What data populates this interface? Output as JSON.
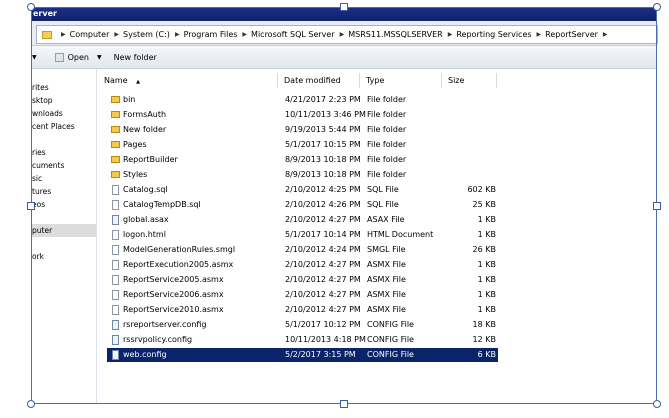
{
  "window": {
    "title_fragment": "erver"
  },
  "address": {
    "crumbs": [
      "Computer",
      "System (C:)",
      "Program Files",
      "Microsoft SQL Server",
      "MSRS11.MSSQLSERVER",
      "Reporting Services",
      "ReportServer"
    ]
  },
  "toolbar": {
    "open_label": "Open",
    "new_folder_label": "New folder"
  },
  "nav": {
    "items": [
      "rites",
      "sktop",
      "wnloads",
      "cent Places",
      "ries",
      "cuments",
      "sic",
      "tures",
      "eos",
      "puter",
      "ork"
    ],
    "selected_index": 9
  },
  "columns": {
    "name": "Name",
    "date": "Date modified",
    "type": "Type",
    "size": "Size"
  },
  "files": [
    {
      "name": "bin",
      "date": "4/21/2017 2:23 PM",
      "type": "File folder",
      "size": "",
      "icon": "folder-icon"
    },
    {
      "name": "FormsAuth",
      "date": "10/11/2013 3:46 PM",
      "type": "File folder",
      "size": "",
      "icon": "folder-icon"
    },
    {
      "name": "New folder",
      "date": "9/19/2013 5:44 PM",
      "type": "File folder",
      "size": "",
      "icon": "folder-icon"
    },
    {
      "name": "Pages",
      "date": "5/1/2017 10:15 PM",
      "type": "File folder",
      "size": "",
      "icon": "folder-icon"
    },
    {
      "name": "ReportBuilder",
      "date": "8/9/2013 10:18 PM",
      "type": "File folder",
      "size": "",
      "icon": "folder-icon"
    },
    {
      "name": "Styles",
      "date": "8/9/2013 10:18 PM",
      "type": "File folder",
      "size": "",
      "icon": "folder-icon"
    },
    {
      "name": "Catalog.sql",
      "date": "2/10/2012 4:25 PM",
      "type": "SQL File",
      "size": "602 KB",
      "icon": "file-icon"
    },
    {
      "name": "CatalogTempDB.sql",
      "date": "2/10/2012 4:26 PM",
      "type": "SQL File",
      "size": "25 KB",
      "icon": "file-icon"
    },
    {
      "name": "global.asax",
      "date": "2/10/2012 4:27 PM",
      "type": "ASAX File",
      "size": "1 KB",
      "icon": "config-file-icon"
    },
    {
      "name": "logon.html",
      "date": "5/1/2017 10:14 PM",
      "type": "HTML Document",
      "size": "1 KB",
      "icon": "file-icon"
    },
    {
      "name": "ModelGenerationRules.smgl",
      "date": "2/10/2012 4:24 PM",
      "type": "SMGL File",
      "size": "26 KB",
      "icon": "file-icon"
    },
    {
      "name": "ReportExecution2005.asmx",
      "date": "2/10/2012 4:27 PM",
      "type": "ASMX File",
      "size": "1 KB",
      "icon": "file-icon"
    },
    {
      "name": "ReportService2005.asmx",
      "date": "2/10/2012 4:27 PM",
      "type": "ASMX File",
      "size": "1 KB",
      "icon": "file-icon"
    },
    {
      "name": "ReportService2006.asmx",
      "date": "2/10/2012 4:27 PM",
      "type": "ASMX File",
      "size": "1 KB",
      "icon": "file-icon"
    },
    {
      "name": "ReportService2010.asmx",
      "date": "2/10/2012 4:27 PM",
      "type": "ASMX File",
      "size": "1 KB",
      "icon": "file-icon"
    },
    {
      "name": "rsreportserver.config",
      "date": "5/1/2017 10:12 PM",
      "type": "CONFIG File",
      "size": "18 KB",
      "icon": "config-file-icon"
    },
    {
      "name": "rssrvpolicy.config",
      "date": "10/11/2013 4:18 PM",
      "type": "CONFIG File",
      "size": "12 KB",
      "icon": "config-file-icon"
    },
    {
      "name": "web.config",
      "date": "5/2/2017 3:15 PM",
      "type": "CONFIG File",
      "size": "6 KB",
      "icon": "config-file-icon"
    }
  ],
  "selected_file_index": 17,
  "colors": {
    "title_bar": "#10206a",
    "selection": "#0a246a",
    "folder": "#f3c94e"
  }
}
